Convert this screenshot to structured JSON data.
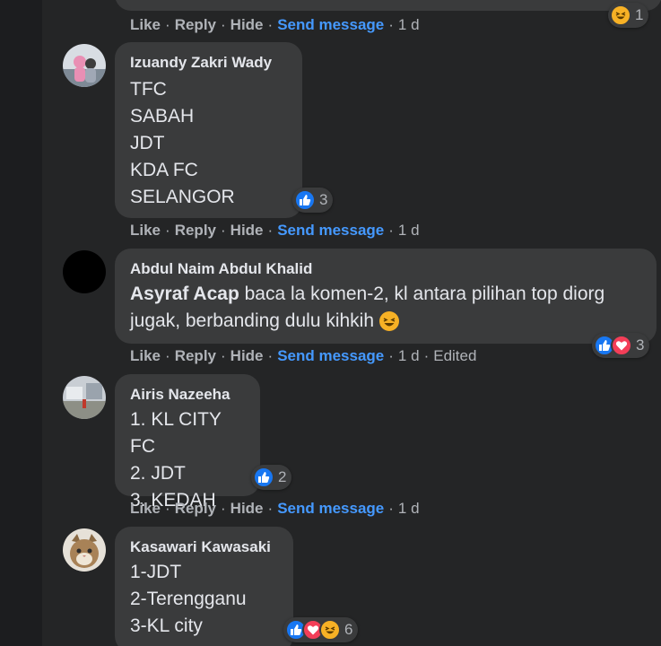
{
  "actions_labels": {
    "like": "Like",
    "reply": "Reply",
    "hide": "Hide",
    "send": "Send message",
    "sep": "·"
  },
  "top": {
    "time": "1 d",
    "reaction_count": "1"
  },
  "comments": [
    {
      "author": "Izuandy Zakri Wady",
      "lines": [
        "TFC",
        "SABAH",
        "JDT",
        "KDA FC",
        "SELANGOR"
      ],
      "reaction_count": "3",
      "time": "1 d"
    },
    {
      "author": "Abdul Naim Abdul Khalid",
      "mention": "Asyraf Acap",
      "line1_rest": " baca la komen-2, kl antara pilihan top diorg",
      "line2": "jugak, berbanding dulu kihkih",
      "reaction_count": "3",
      "time": "1 d",
      "edited": "Edited"
    },
    {
      "author": "Airis Nazeeha",
      "lines": [
        "1. KL CITY FC",
        "2. JDT",
        "3. KEDAH"
      ],
      "reaction_count": "2",
      "time": "1 d"
    },
    {
      "author": "Kasawari Kawasaki",
      "lines": [
        "1-JDT",
        "2-Terengganu",
        "3-KL city"
      ],
      "reaction_count": "6"
    }
  ],
  "colors": {
    "link": "#4599ff",
    "like": "#1877f2",
    "love": "#f33e58",
    "haha": "#f7b125",
    "bubble": "#3a3b3c"
  },
  "icons": [
    "like-reaction-icon",
    "love-reaction-icon",
    "haha-reaction-icon",
    "avatar"
  ]
}
